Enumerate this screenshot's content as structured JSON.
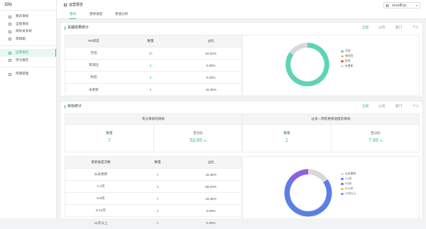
{
  "sidebar": {
    "title": "目标",
    "items": [
      {
        "label": "我的目标"
      },
      {
        "label": "全部目标"
      },
      {
        "label": "目标关系树"
      },
      {
        "label": "草稿箱"
      },
      {
        "label": "运营报告"
      },
      {
        "label": "评分报告"
      },
      {
        "label": "周期管理"
      }
    ]
  },
  "header": {
    "breadcrumb": "运营报告",
    "period": "2018年Q1",
    "tabs": [
      {
        "label": "整体"
      },
      {
        "label": "更新进度"
      },
      {
        "label": "更值分析"
      }
    ]
  },
  "filters": [
    "全部",
    "公司",
    "部门",
    "个人"
  ],
  "kr_panel": {
    "title": "关键结果统计",
    "headers": [
      "KR状态",
      "数量",
      "占比"
    ],
    "rows": [
      {
        "status": "可控",
        "count": "20",
        "pct": "84.62%"
      },
      {
        "status": "有风险",
        "count": "0",
        "pct": "0.00%"
      },
      {
        "status": "失控",
        "count": "0",
        "pct": "0.00%"
      },
      {
        "status": "未更新",
        "count": "6",
        "pct": "15.38%"
      }
    ],
    "legend": [
      {
        "label": "可控",
        "color": "#5fd3b7"
      },
      {
        "label": "有风险",
        "color": "#f5c342"
      },
      {
        "label": "失控",
        "color": "#e0584f"
      },
      {
        "label": "未更新",
        "color": "#d9d9d9"
      }
    ]
  },
  "goal_panel": {
    "title": "目标统计",
    "left": {
      "heading": "有父目标的目标",
      "count_label": "数量",
      "count": "7",
      "pct_label": "百分比",
      "pct": "53.85",
      "pct_unit": "%"
    },
    "right": {
      "heading": "过去一周有更新进度的目标",
      "count_label": "数量",
      "count": "1",
      "pct_label": "百分比",
      "pct": "7.69",
      "pct_unit": "%"
    },
    "freq_headers": [
      "更新进度次数",
      "数量",
      "占比"
    ],
    "freq_rows": [
      {
        "label": "从未更新",
        "count": "2",
        "pct": "15.38%"
      },
      {
        "label": "1-4次",
        "count": "9",
        "pct": "69.23%"
      },
      {
        "label": "5-8次",
        "count": "2",
        "pct": "15.38%"
      },
      {
        "label": "8-12次",
        "count": "0",
        "pct": "0.00%"
      },
      {
        "label": "12次以上",
        "count": "0",
        "pct": "0.00%"
      }
    ],
    "legend": [
      {
        "label": "从未更新",
        "color": "#d9d9d9"
      },
      {
        "label": "1-4次",
        "color": "#5b7fe6"
      },
      {
        "label": "5-8次",
        "color": "#8a63e0"
      },
      {
        "label": "8-12次",
        "color": "#f5c342"
      },
      {
        "label": "12次以上",
        "color": "#6fa0f0"
      }
    ]
  },
  "chart_data": [
    {
      "type": "pie",
      "categories": [
        "可控",
        "有风险",
        "失控",
        "未更新"
      ],
      "values": [
        84.62,
        0,
        0,
        15.38
      ]
    },
    {
      "type": "pie",
      "categories": [
        "从未更新",
        "1-4次",
        "5-8次",
        "8-12次",
        "12次以上"
      ],
      "values": [
        15.38,
        69.23,
        15.38,
        0,
        0
      ]
    }
  ]
}
